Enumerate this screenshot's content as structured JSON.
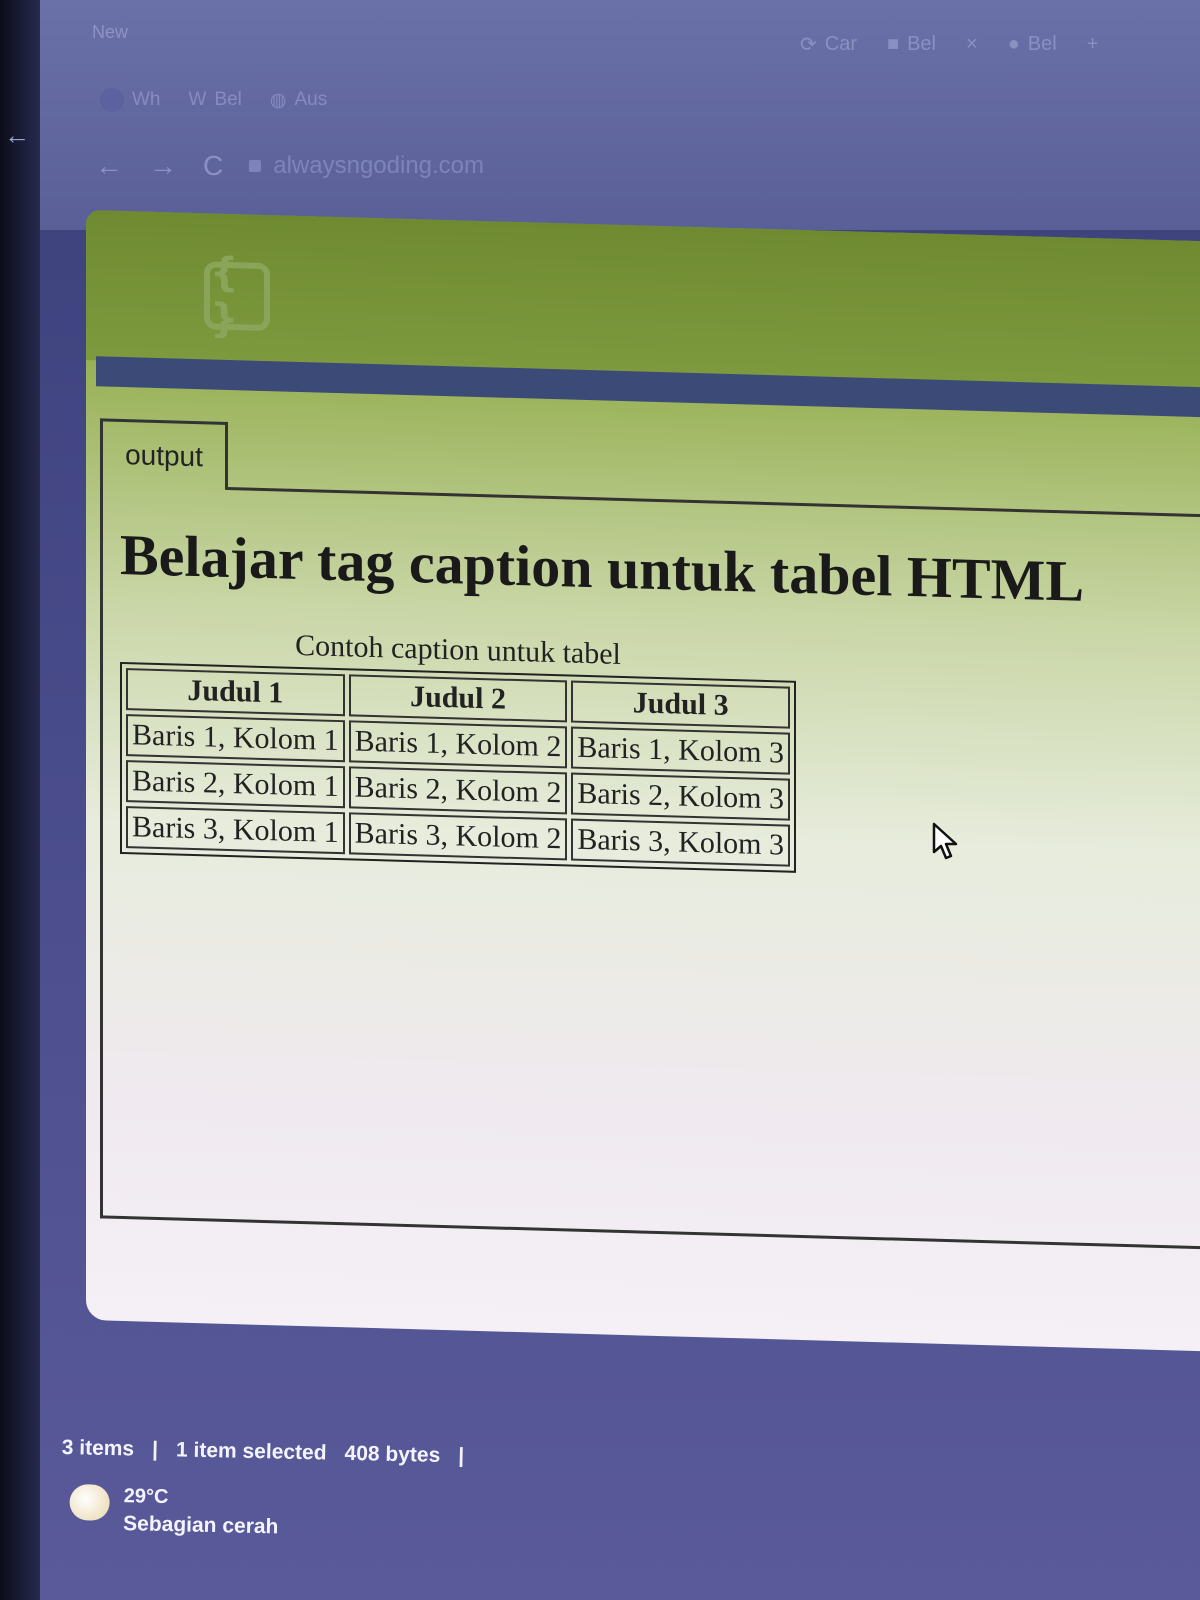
{
  "browser": {
    "new_tab_label": "New",
    "tabs_row1": [
      "Car",
      "Bel",
      "Bel"
    ],
    "tabs_row2": [
      "Wh",
      "Bel",
      "Aus"
    ],
    "new_tab_symbol": "+",
    "address": "alwaysngoding.com"
  },
  "page": {
    "output_tab_label": "output",
    "heading": "Belajar tag caption untuk tabel HTML",
    "table": {
      "caption": "Contoh caption untuk tabel",
      "headers": [
        "Judul 1",
        "Judul 2",
        "Judul 3"
      ],
      "rows": [
        [
          "Baris 1, Kolom 1",
          "Baris 1, Kolom 2",
          "Baris 1, Kolom 3"
        ],
        [
          "Baris 2, Kolom 1",
          "Baris 2, Kolom 2",
          "Baris 2, Kolom 3"
        ],
        [
          "Baris 3, Kolom 1",
          "Baris 3, Kolom 2",
          "Baris 3, Kolom 3"
        ]
      ]
    }
  },
  "status_bar": {
    "items_count": "3 items",
    "separator": "|",
    "selected": "1 item selected",
    "size": "408 bytes"
  },
  "weather": {
    "temperature": "29°C",
    "condition": "Sebagian cerah"
  }
}
